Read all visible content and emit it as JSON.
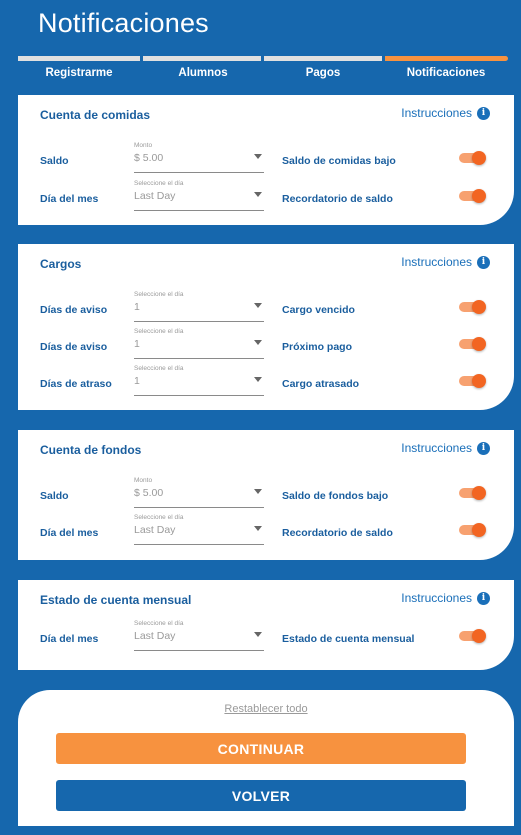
{
  "header": {
    "title": "Notificaciones"
  },
  "progress": {
    "step_count": 4,
    "current_step": 4,
    "colors": {
      "done": "#e0e0e0",
      "current": "#f7923f"
    }
  },
  "steps": [
    "Registrarme",
    "Alumnos",
    "Pagos",
    "Notificaciones"
  ],
  "instructions_label": "Instrucciones",
  "sections": {
    "meals": {
      "title": "Cuenta de comidas",
      "rows": [
        {
          "label": "Saldo",
          "caption": "Monto",
          "value": "$ 5.00",
          "toggle_label": "Saldo de comidas bajo",
          "on": true
        },
        {
          "label": "Día del mes",
          "caption": "Seleccione el día",
          "value": "Last Day",
          "toggle_label": "Recordatorio de saldo",
          "on": true
        }
      ]
    },
    "charges": {
      "title": "Cargos",
      "rows": [
        {
          "label": "Días de aviso",
          "caption": "Seleccione el día",
          "value": "1",
          "toggle_label": "Cargo vencido",
          "on": true
        },
        {
          "label": "Días de aviso",
          "caption": "Seleccione el día",
          "value": "1",
          "toggle_label": "Próximo pago",
          "on": true
        },
        {
          "label": "Días de atraso",
          "caption": "Seleccione el día",
          "value": "1",
          "toggle_label": "Cargo atrasado",
          "on": true
        }
      ]
    },
    "funds": {
      "title": "Cuenta de fondos",
      "rows": [
        {
          "label": "Saldo",
          "caption": "Monto",
          "value": "$ 5.00",
          "toggle_label": "Saldo de fondos bajo",
          "on": true
        },
        {
          "label": "Día del mes",
          "caption": "Seleccione el día",
          "value": "Last Day",
          "toggle_label": "Recordatorio de saldo",
          "on": true
        }
      ]
    },
    "statement": {
      "title": "Estado de cuenta mensual",
      "rows": [
        {
          "label": "Día del mes",
          "caption": "Seleccione el día",
          "value": "Last Day",
          "toggle_label": "Estado de cuenta mensual",
          "on": true
        }
      ]
    }
  },
  "footer": {
    "reset_label": "Restablecer todo",
    "continue_label": "CONTINUAR",
    "back_label": "VOLVER"
  },
  "colors": {
    "brand_blue": "#1667ad",
    "accent_orange": "#f7923f",
    "toggle_on": "#f26522"
  }
}
